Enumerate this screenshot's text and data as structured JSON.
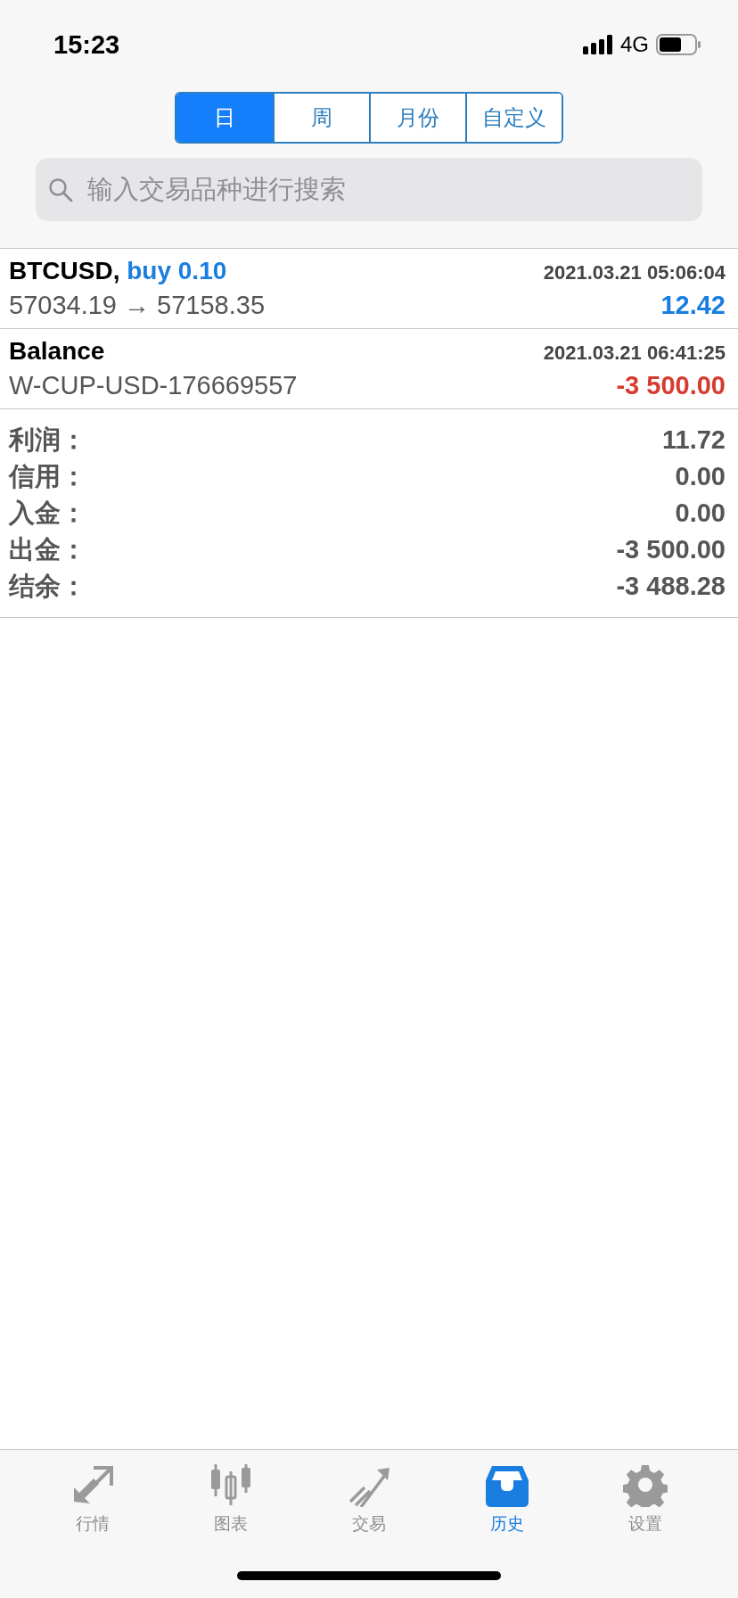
{
  "status_bar": {
    "time": "15:23",
    "network": "4G"
  },
  "period_tabs": [
    {
      "label": "日",
      "selected": true
    },
    {
      "label": "周",
      "selected": false
    },
    {
      "label": "月份",
      "selected": false
    },
    {
      "label": "自定义",
      "selected": false
    }
  ],
  "search": {
    "placeholder": "输入交易品种进行搜索"
  },
  "deals": [
    {
      "kind": "trade",
      "symbol": "BTCUSD,",
      "order": "buy 0.10",
      "detail": "57034.19 → 57158.35",
      "time": "2021.03.21 05:06:04",
      "amount": "12.42",
      "color": "#1a7ee0"
    },
    {
      "kind": "balance",
      "symbol": "Balance",
      "detail": "W-CUP-USD-176669557",
      "time": "2021.03.21 06:41:25",
      "amount": "-3 500.00",
      "color": "#d63b30"
    }
  ],
  "summary": [
    {
      "label": "利润：",
      "value": "11.72"
    },
    {
      "label": "信用：",
      "value": "0.00"
    },
    {
      "label": "入金：",
      "value": "0.00"
    },
    {
      "label": "出金：",
      "value": "-3 500.00"
    },
    {
      "label": "结余：",
      "value": "-3 488.28"
    }
  ],
  "tab_bar": [
    {
      "label": "行情",
      "selected": false
    },
    {
      "label": "图表",
      "selected": false
    },
    {
      "label": "交易",
      "selected": false
    },
    {
      "label": "历史",
      "selected": true
    },
    {
      "label": "设置",
      "selected": false
    }
  ]
}
